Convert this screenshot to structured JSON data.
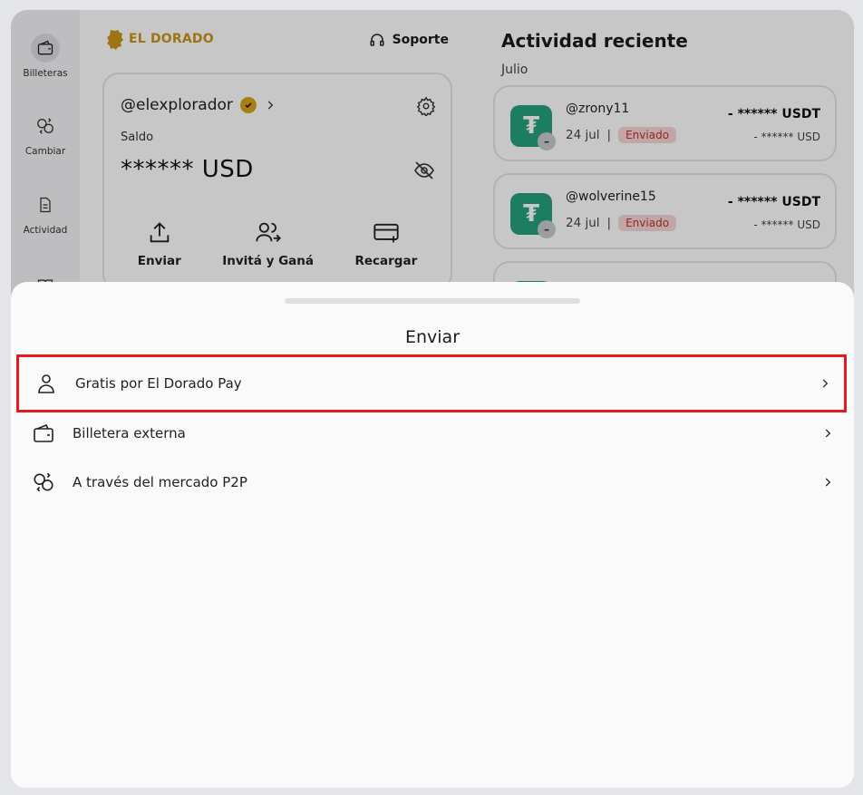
{
  "rail": {
    "items": [
      {
        "label": "Billeteras",
        "icon": "wallet-icon",
        "active": true
      },
      {
        "label": "Cambiar",
        "icon": "exchange-icon",
        "active": false
      },
      {
        "label": "Actividad",
        "icon": "document-icon",
        "active": false
      }
    ]
  },
  "brand": {
    "name": "EL DORADO",
    "color": "#c9951a"
  },
  "support": {
    "label": "Soporte"
  },
  "wallet": {
    "username": "@elexplorador",
    "balance_label": "Saldo",
    "balance_value": "****** USD",
    "actions": [
      {
        "label": "Enviar",
        "icon": "upload-icon"
      },
      {
        "label": "Invitá y Ganá",
        "icon": "invite-users-icon"
      },
      {
        "label": "Recargar",
        "icon": "card-add-icon"
      }
    ]
  },
  "activity": {
    "title": "Actividad reciente",
    "month": "Julio",
    "transactions": [
      {
        "user": "@zrony11",
        "date": "24 jul",
        "status": "Enviado",
        "amount": "- ****** USDT",
        "sub": "- ****** USD"
      },
      {
        "user": "@wolverine15",
        "date": "24 jul",
        "status": "Enviado",
        "amount": "- ****** USDT",
        "sub": "- ****** USD"
      }
    ]
  },
  "sheet": {
    "title": "Enviar",
    "options": [
      {
        "label": "Gratis por El Dorado Pay",
        "icon": "user-icon",
        "highlighted": true
      },
      {
        "label": "Billetera externa",
        "icon": "wallet-icon",
        "highlighted": false
      },
      {
        "label": "A través del mercado P2P",
        "icon": "exchange-icon",
        "highlighted": false
      }
    ]
  },
  "colors": {
    "accent": "#c9951a",
    "tether": "#26a17b",
    "status_sent": "#c4302b",
    "highlight_border": "#e01b1b"
  }
}
